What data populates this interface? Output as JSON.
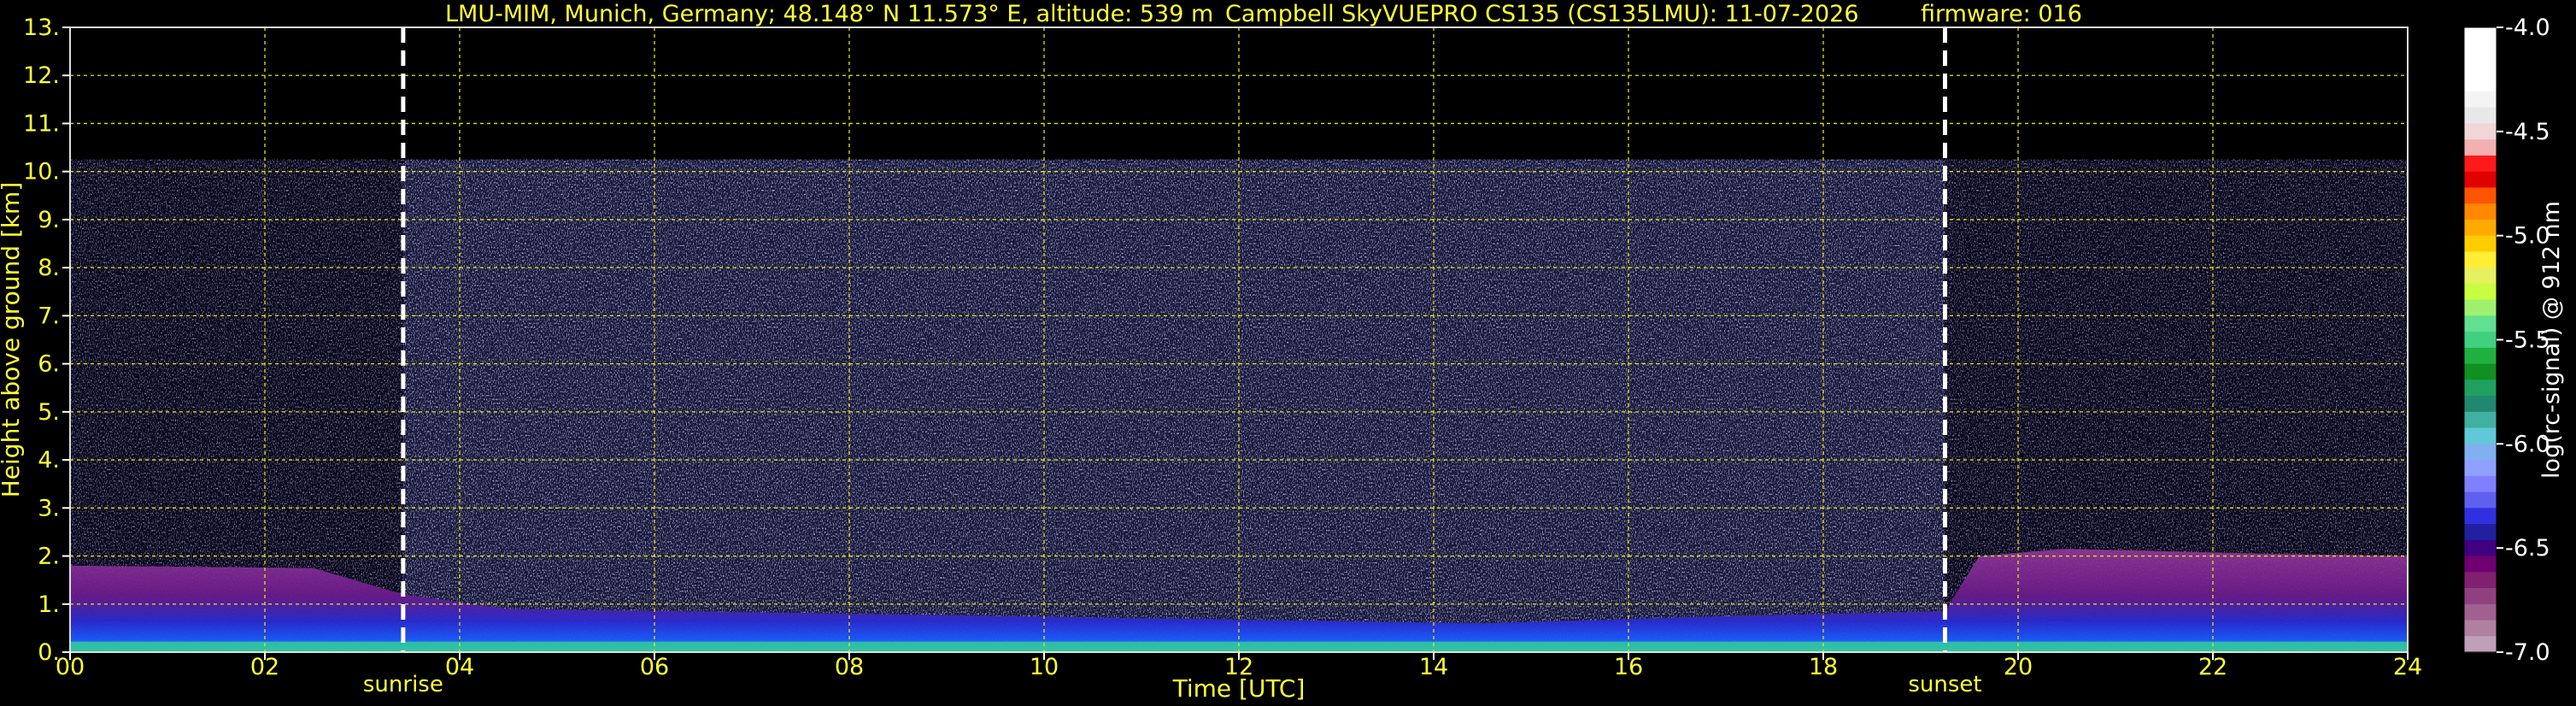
{
  "chart_data": {
    "type": "heatmap",
    "title_parts": [
      "LMU-MIM, Munich, Germany; 48.148° N 11.573° E, altitude: 539 m",
      "Campbell SkyVUEPRO CS135 (CS135LMU): 11-07-2026",
      "firmware: 016"
    ],
    "xlabel": "Time [UTC]",
    "ylabel": "Height above ground [km]",
    "xlim": [
      0,
      24
    ],
    "ylim": [
      0,
      13
    ],
    "x_ticks": [
      0,
      2,
      4,
      6,
      8,
      10,
      12,
      14,
      16,
      18,
      20,
      22,
      24
    ],
    "x_tick_labels": [
      "00",
      "02",
      "04",
      "06",
      "08",
      "10",
      "12",
      "14",
      "16",
      "18",
      "20",
      "22",
      "24"
    ],
    "y_ticks": [
      0,
      1,
      2,
      3,
      4,
      5,
      6,
      7,
      8,
      9,
      10,
      11,
      12,
      13
    ],
    "y_tick_labels": [
      "0.",
      "1.",
      "2.",
      "3.",
      "4.",
      "5.",
      "6.",
      "7.",
      "8.",
      "9.",
      "10.",
      "11.",
      "12.",
      "13."
    ],
    "grid": true,
    "events": [
      {
        "label": "sunrise",
        "time": 3.42
      },
      {
        "label": "sunset",
        "time": 19.25
      }
    ],
    "data_top_km": 10.25,
    "boundary_layer_top_km": [
      {
        "time": 0,
        "km": 1.8
      },
      {
        "time": 2.5,
        "km": 1.75
      },
      {
        "time": 3.42,
        "km": 1.2
      },
      {
        "time": 4.5,
        "km": 0.9
      },
      {
        "time": 8,
        "km": 0.8
      },
      {
        "time": 14.5,
        "km": 0.6
      },
      {
        "time": 17,
        "km": 0.75
      },
      {
        "time": 19.25,
        "km": 0.85
      },
      {
        "time": 19.6,
        "km": 2.0
      },
      {
        "time": 20.5,
        "km": 2.15
      },
      {
        "time": 22.5,
        "km": 2.05
      },
      {
        "time": 24,
        "km": 2.0
      }
    ],
    "colorbar": {
      "label": "log(rc-signal) @ 912 nm",
      "range": [
        -7.0,
        -4.0
      ],
      "tick_values": [
        -4.0,
        -4.5,
        -5.0,
        -5.5,
        -6.0,
        -6.5,
        -7.0
      ],
      "tick_labels": [
        "-4.0",
        "-4.5",
        "-5.0",
        "-5.5",
        "-6.0",
        "-6.5",
        "-7.0"
      ],
      "colors_top_to_bottom": [
        "#ffffff",
        "#ffffff",
        "#ffffff",
        "#ffffff",
        "#f4f4f4",
        "#e8e8e8",
        "#f0d6d6",
        "#f2b0b0",
        "#ff1a1a",
        "#e00000",
        "#ff5500",
        "#ff8800",
        "#ffaa00",
        "#ffcc00",
        "#ffee33",
        "#e6f060",
        "#c8ff40",
        "#a0f070",
        "#60e090",
        "#40d080",
        "#20b040",
        "#109020",
        "#20a060",
        "#208870",
        "#40b0a0",
        "#60c8d8",
        "#80b0f0",
        "#90a0ff",
        "#8080ff",
        "#6060f0",
        "#3030e0",
        "#2020a0",
        "#400080",
        "#700070",
        "#802070",
        "#904080",
        "#a06090",
        "#b080a0",
        "#c0a0b8"
      ]
    }
  }
}
